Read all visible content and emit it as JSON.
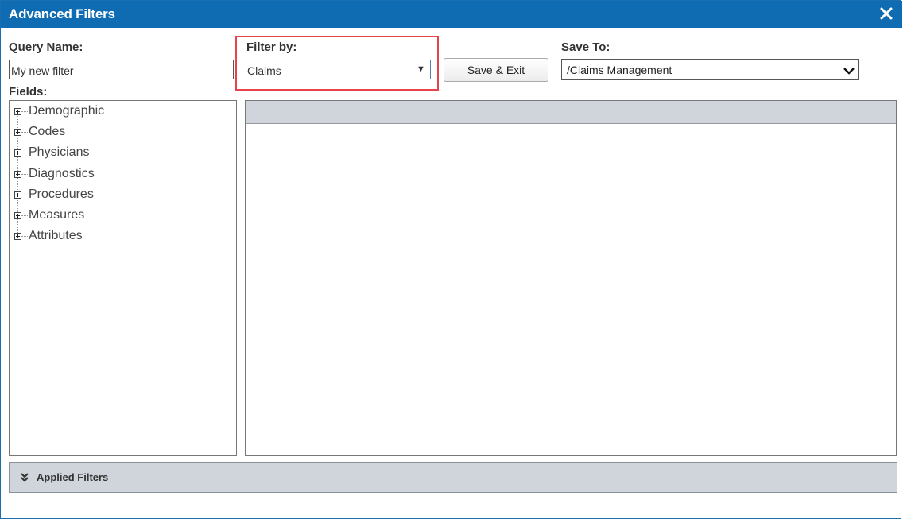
{
  "dialog": {
    "title": "Advanced Filters",
    "close_icon": "close-icon"
  },
  "query_name": {
    "label": "Query Name:",
    "value": "My new filter"
  },
  "filter_by": {
    "label": "Filter by:",
    "selected": "Claims",
    "arrow_icon": "caret-down-icon",
    "highlight_color": "#e8434c"
  },
  "save_exit": {
    "label": "Save & Exit"
  },
  "save_to": {
    "label": "Save To:",
    "selected": "/Claims Management",
    "arrow_icon": "chevron-down-icon"
  },
  "fields": {
    "label": "Fields:",
    "items": [
      {
        "label": "Demographic"
      },
      {
        "label": "Codes"
      },
      {
        "label": "Physicians"
      },
      {
        "label": "Diagnostics"
      },
      {
        "label": "Procedures"
      },
      {
        "label": "Measures"
      },
      {
        "label": "Attributes"
      }
    ]
  },
  "applied_filters": {
    "label": "Applied Filters",
    "icon": "double-chevron-down-icon"
  },
  "colors": {
    "titlebar": "#0f6cb3",
    "panel_header": "#cfd5da"
  }
}
